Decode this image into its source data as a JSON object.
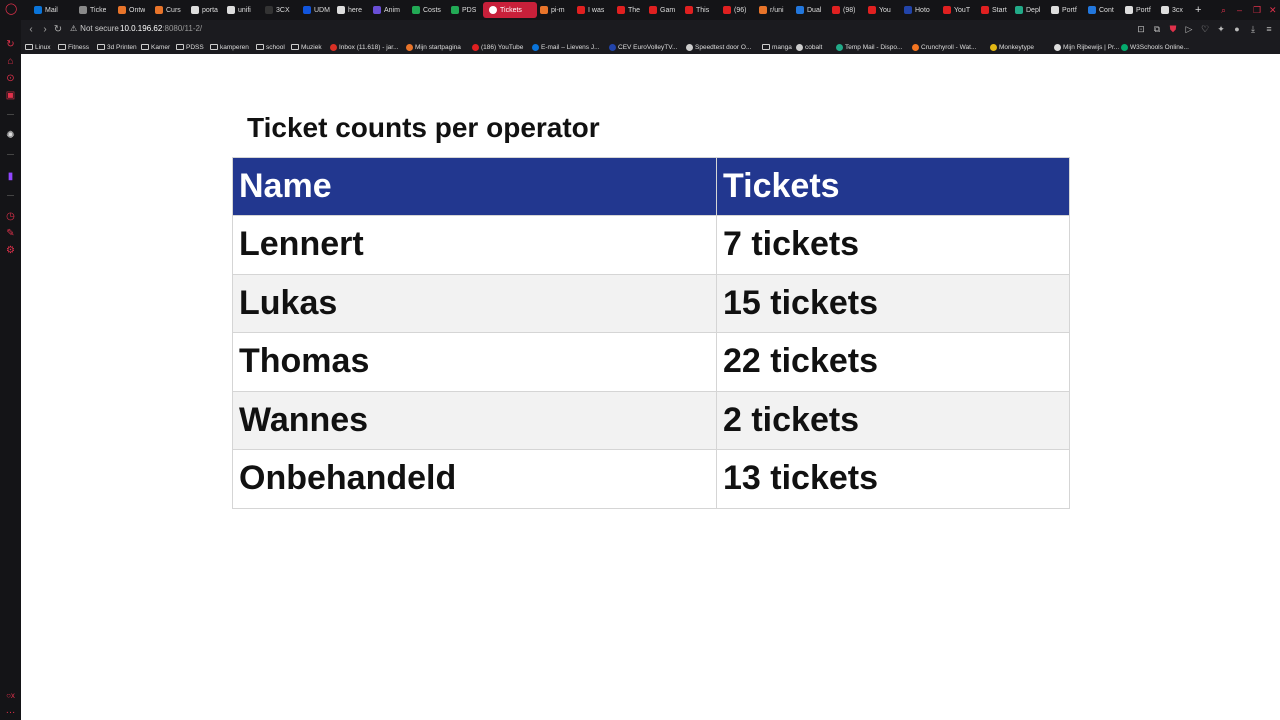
{
  "browser": {
    "tabs": [
      {
        "label": "Mail",
        "color": "#0a74d9"
      },
      {
        "label": "Ticke",
        "color": "#888888"
      },
      {
        "label": "Ontw",
        "color": "#e8742a"
      },
      {
        "label": "Curs",
        "color": "#e8742a"
      },
      {
        "label": "porta",
        "color": "#dddddd"
      },
      {
        "label": "unifi",
        "color": "#dddddd"
      },
      {
        "label": "3CX",
        "color": "#333333"
      },
      {
        "label": "UDM",
        "color": "#1155dd"
      },
      {
        "label": "here",
        "color": "#dddddd"
      },
      {
        "label": "Anim",
        "color": "#6a4fd6"
      },
      {
        "label": "Costs",
        "color": "#22aa55"
      },
      {
        "label": "PDS",
        "color": "#22aa55"
      },
      {
        "label": "Tickets",
        "color": "#ffffff"
      },
      {
        "label": "pi-m",
        "color": "#e8742a"
      },
      {
        "label": "I was",
        "color": "#e02020"
      },
      {
        "label": "The",
        "color": "#e02020"
      },
      {
        "label": "Gam",
        "color": "#e02020"
      },
      {
        "label": "This",
        "color": "#e02020"
      },
      {
        "label": "(96)",
        "color": "#e02020"
      },
      {
        "label": "r/uni",
        "color": "#e8742a"
      },
      {
        "label": "Dual",
        "color": "#2277dd"
      },
      {
        "label": "(98)",
        "color": "#e02020"
      },
      {
        "label": "You",
        "color": "#e02020"
      },
      {
        "label": "Hoto",
        "color": "#2244aa"
      },
      {
        "label": "YouT",
        "color": "#e02020"
      },
      {
        "label": "Start",
        "color": "#e02020"
      },
      {
        "label": "Depl",
        "color": "#22aa88"
      },
      {
        "label": "Portf",
        "color": "#dddddd"
      },
      {
        "label": "Cont",
        "color": "#2277dd"
      },
      {
        "label": "Portf",
        "color": "#dddddd"
      },
      {
        "label": "3cx",
        "color": "#dddddd"
      }
    ],
    "new_tab": "+",
    "security_label": "Not secure",
    "url_host": "10.0.196.62",
    "url_path": ":8080/11-2/",
    "bookmarks": [
      {
        "label": "Linux",
        "kind": "folder"
      },
      {
        "label": "Fitness",
        "kind": "folder"
      },
      {
        "label": "3d Printen",
        "kind": "folder"
      },
      {
        "label": "Kamer",
        "kind": "folder"
      },
      {
        "label": "PDSS",
        "kind": "folder"
      },
      {
        "label": "kamperen",
        "kind": "folder"
      },
      {
        "label": "school",
        "kind": "folder"
      },
      {
        "label": "Muziek",
        "kind": "folder"
      },
      {
        "label": "Inbox (11.618) - jar...",
        "kind": "gmail"
      },
      {
        "label": "Mijn startpagina",
        "kind": "orange"
      },
      {
        "label": "(186) YouTube",
        "kind": "youtube"
      },
      {
        "label": "E-mail – Lievens J...",
        "kind": "outlook"
      },
      {
        "label": "CEV EuroVolleyTV...",
        "kind": "cev"
      },
      {
        "label": "Speedtest door O...",
        "kind": "speed"
      },
      {
        "label": "manga",
        "kind": "folder"
      },
      {
        "label": "cobalt",
        "kind": "cobalt"
      },
      {
        "label": "Temp Mail - Dispo...",
        "kind": "temp"
      },
      {
        "label": "Crunchyroll - Wat...",
        "kind": "crunchy"
      },
      {
        "label": "Monkeytype",
        "kind": "monkey"
      },
      {
        "label": "Mijn Rijbewijs | Pr...",
        "kind": "rij"
      },
      {
        "label": "W3Schools Online...",
        "kind": "w3"
      }
    ]
  },
  "page": {
    "title": "Ticket counts per operator",
    "table": {
      "headers": [
        "Name",
        "Tickets"
      ],
      "rows": [
        {
          "name": "Lennert",
          "tickets": "7 tickets",
          "status": "ok"
        },
        {
          "name": "Lukas",
          "tickets": "15 tickets",
          "status": "ok"
        },
        {
          "name": "Thomas",
          "tickets": "22 tickets",
          "status": "ok"
        },
        {
          "name": "Wannes",
          "tickets": "2 tickets",
          "status": "ok"
        },
        {
          "name": "Onbehandeld",
          "tickets": "13 tickets",
          "status": "unhandled"
        }
      ]
    }
  },
  "colors": {
    "header_bg": "#22378f",
    "count_green": "#0e8a45",
    "unhandled_red": "#ee1111",
    "browser_accent": "#c8203a"
  }
}
